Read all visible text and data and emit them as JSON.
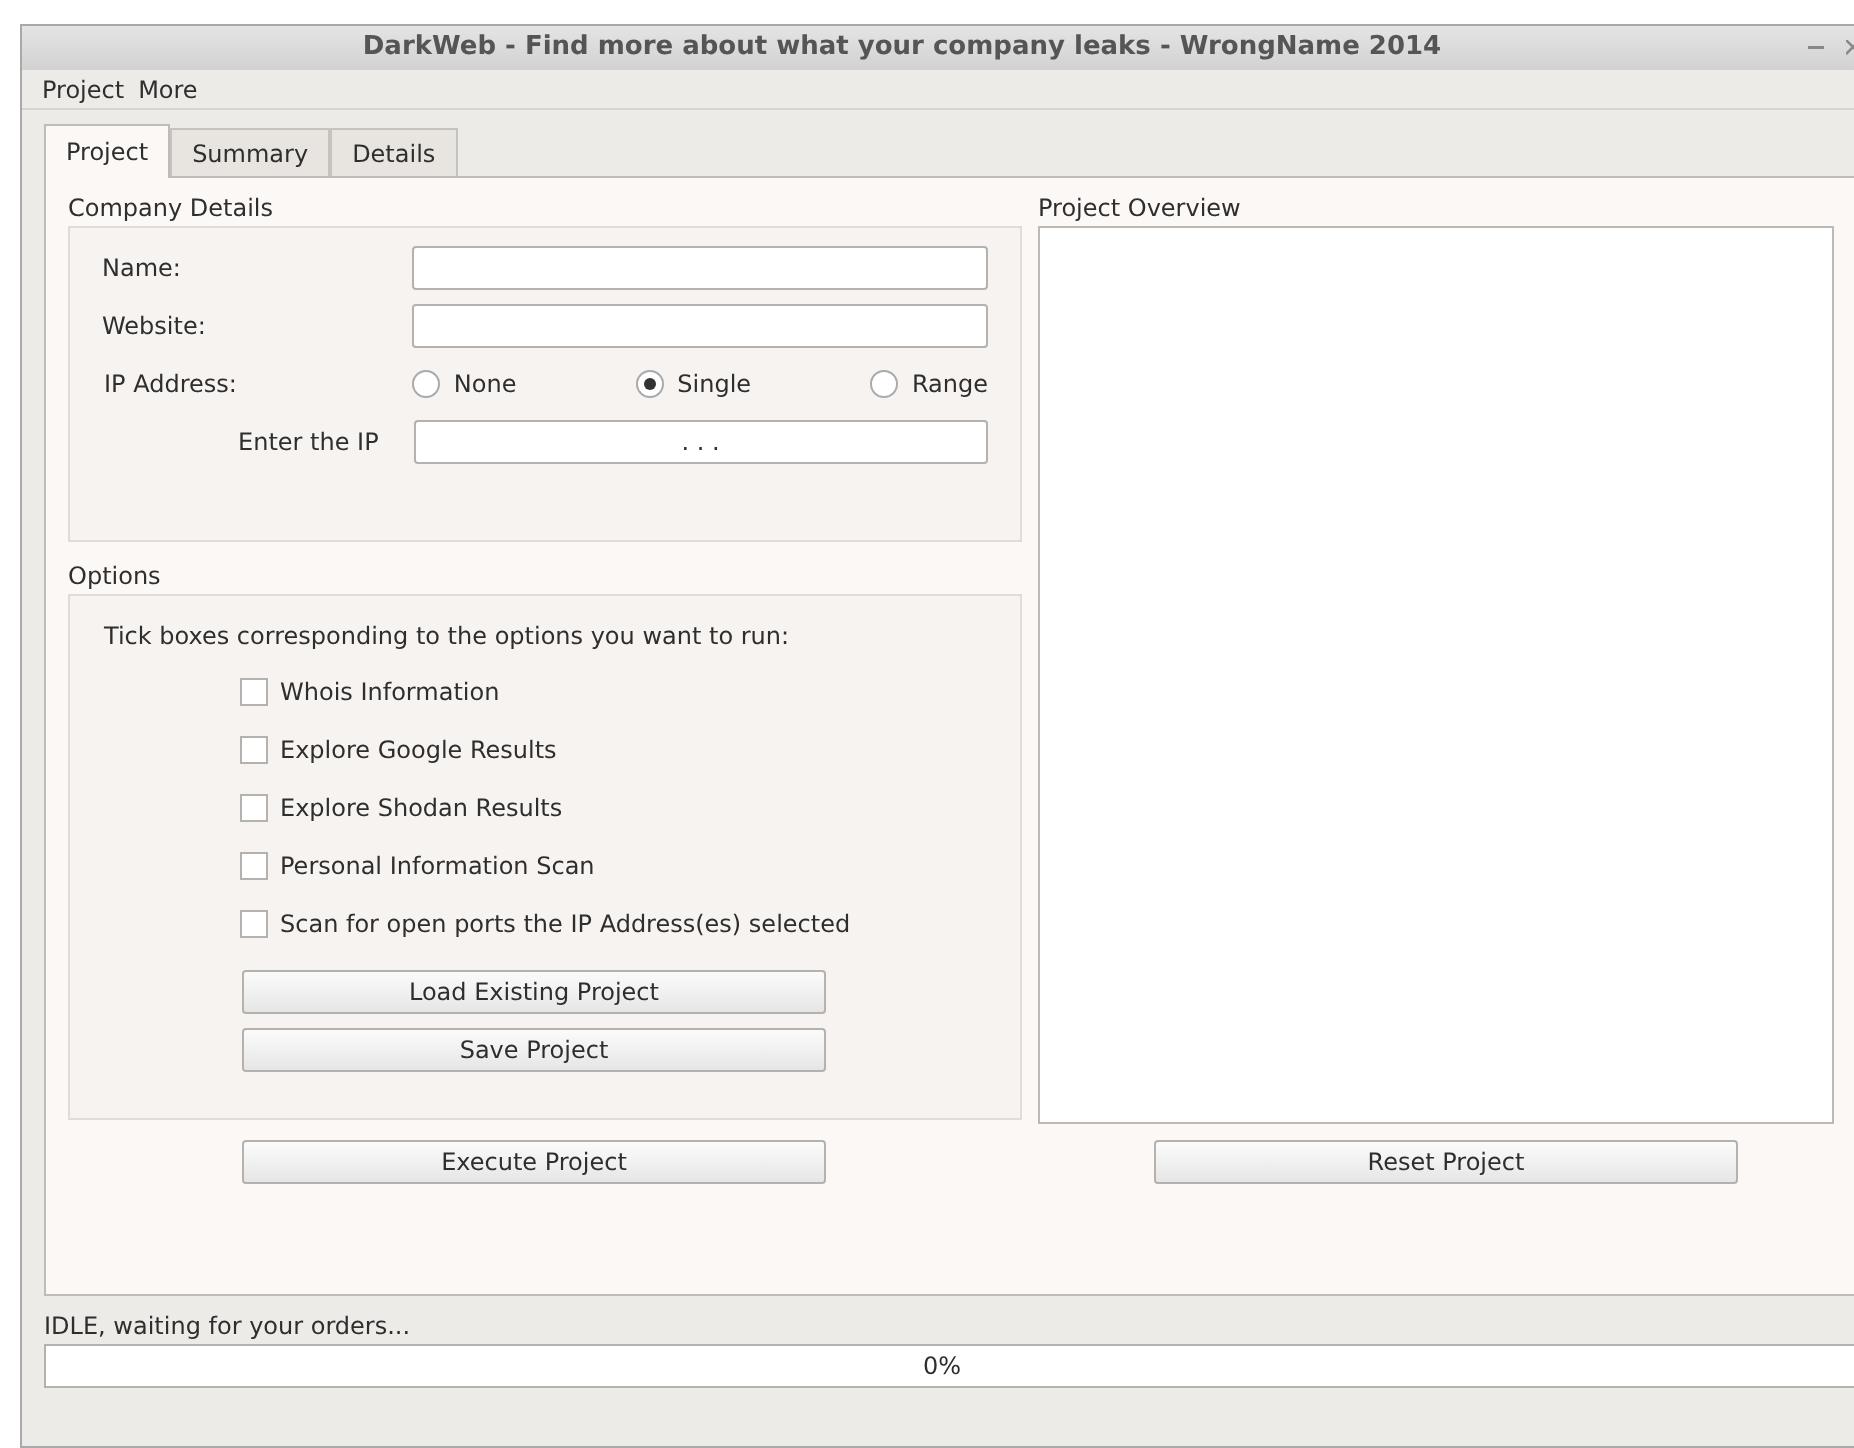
{
  "window": {
    "title": "DarkWeb - Find more about what your company leaks - WrongName 2014"
  },
  "menu": [
    "Project",
    "More"
  ],
  "tabs": [
    {
      "label": "Project",
      "selected": true
    },
    {
      "label": "Summary",
      "selected": false
    },
    {
      "label": "Details",
      "selected": false
    }
  ],
  "company_details": {
    "title": "Company Details",
    "fields": [
      {
        "label": "Name:"
      },
      {
        "label": "Website:"
      }
    ],
    "ip_label": "IP Address:",
    "ip_options": [
      {
        "label": "None",
        "selected": false
      },
      {
        "label": "Single",
        "selected": true
      },
      {
        "label": "Range",
        "selected": false
      }
    ],
    "ip_entry": {
      "label": "Enter the IP",
      "value": ". . ."
    }
  },
  "options": {
    "title": "Options",
    "instruction": "Tick boxes corresponding to the options you want to run:",
    "checkboxes": [
      {
        "label": "Whois Information",
        "checked": false
      },
      {
        "label": "Explore Google Results",
        "checked": false
      },
      {
        "label": "Explore Shodan Results",
        "checked": false
      },
      {
        "label": "Personal Information Scan",
        "checked": false
      },
      {
        "label": "Scan for open ports the IP Address(es) selected",
        "checked": false
      }
    ],
    "buttons": [
      "Load Existing Project",
      "Save Project"
    ]
  },
  "project_overview": {
    "title": "Project Overview"
  },
  "actions": [
    "Execute Project",
    "Reset Project"
  ],
  "status": {
    "text": "IDLE, waiting for your orders...",
    "progress": {
      "level": 0,
      "reading": "0%"
    }
  }
}
